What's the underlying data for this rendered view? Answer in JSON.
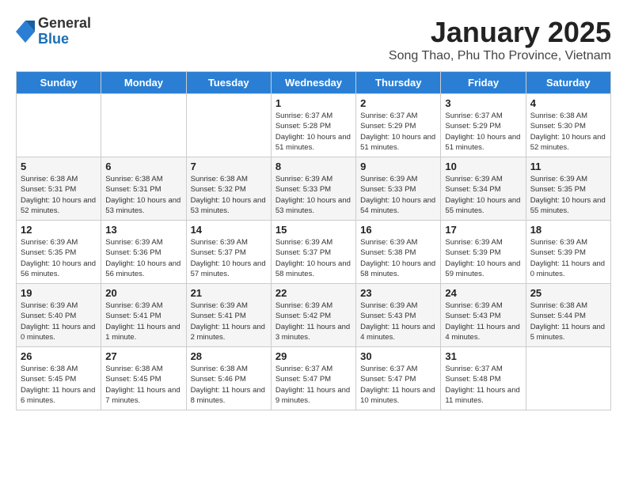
{
  "header": {
    "logo_general": "General",
    "logo_blue": "Blue",
    "month_title": "January 2025",
    "location": "Song Thao, Phu Tho Province, Vietnam"
  },
  "days_of_week": [
    "Sunday",
    "Monday",
    "Tuesday",
    "Wednesday",
    "Thursday",
    "Friday",
    "Saturday"
  ],
  "weeks": [
    [
      {
        "day": "",
        "info": ""
      },
      {
        "day": "",
        "info": ""
      },
      {
        "day": "",
        "info": ""
      },
      {
        "day": "1",
        "info": "Sunrise: 6:37 AM\nSunset: 5:28 PM\nDaylight: 10 hours\nand 51 minutes."
      },
      {
        "day": "2",
        "info": "Sunrise: 6:37 AM\nSunset: 5:29 PM\nDaylight: 10 hours\nand 51 minutes."
      },
      {
        "day": "3",
        "info": "Sunrise: 6:37 AM\nSunset: 5:29 PM\nDaylight: 10 hours\nand 51 minutes."
      },
      {
        "day": "4",
        "info": "Sunrise: 6:38 AM\nSunset: 5:30 PM\nDaylight: 10 hours\nand 52 minutes."
      }
    ],
    [
      {
        "day": "5",
        "info": "Sunrise: 6:38 AM\nSunset: 5:31 PM\nDaylight: 10 hours\nand 52 minutes."
      },
      {
        "day": "6",
        "info": "Sunrise: 6:38 AM\nSunset: 5:31 PM\nDaylight: 10 hours\nand 53 minutes."
      },
      {
        "day": "7",
        "info": "Sunrise: 6:38 AM\nSunset: 5:32 PM\nDaylight: 10 hours\nand 53 minutes."
      },
      {
        "day": "8",
        "info": "Sunrise: 6:39 AM\nSunset: 5:33 PM\nDaylight: 10 hours\nand 53 minutes."
      },
      {
        "day": "9",
        "info": "Sunrise: 6:39 AM\nSunset: 5:33 PM\nDaylight: 10 hours\nand 54 minutes."
      },
      {
        "day": "10",
        "info": "Sunrise: 6:39 AM\nSunset: 5:34 PM\nDaylight: 10 hours\nand 55 minutes."
      },
      {
        "day": "11",
        "info": "Sunrise: 6:39 AM\nSunset: 5:35 PM\nDaylight: 10 hours\nand 55 minutes."
      }
    ],
    [
      {
        "day": "12",
        "info": "Sunrise: 6:39 AM\nSunset: 5:35 PM\nDaylight: 10 hours\nand 56 minutes."
      },
      {
        "day": "13",
        "info": "Sunrise: 6:39 AM\nSunset: 5:36 PM\nDaylight: 10 hours\nand 56 minutes."
      },
      {
        "day": "14",
        "info": "Sunrise: 6:39 AM\nSunset: 5:37 PM\nDaylight: 10 hours\nand 57 minutes."
      },
      {
        "day": "15",
        "info": "Sunrise: 6:39 AM\nSunset: 5:37 PM\nDaylight: 10 hours\nand 58 minutes."
      },
      {
        "day": "16",
        "info": "Sunrise: 6:39 AM\nSunset: 5:38 PM\nDaylight: 10 hours\nand 58 minutes."
      },
      {
        "day": "17",
        "info": "Sunrise: 6:39 AM\nSunset: 5:39 PM\nDaylight: 10 hours\nand 59 minutes."
      },
      {
        "day": "18",
        "info": "Sunrise: 6:39 AM\nSunset: 5:39 PM\nDaylight: 11 hours\nand 0 minutes."
      }
    ],
    [
      {
        "day": "19",
        "info": "Sunrise: 6:39 AM\nSunset: 5:40 PM\nDaylight: 11 hours\nand 0 minutes."
      },
      {
        "day": "20",
        "info": "Sunrise: 6:39 AM\nSunset: 5:41 PM\nDaylight: 11 hours\nand 1 minute."
      },
      {
        "day": "21",
        "info": "Sunrise: 6:39 AM\nSunset: 5:41 PM\nDaylight: 11 hours\nand 2 minutes."
      },
      {
        "day": "22",
        "info": "Sunrise: 6:39 AM\nSunset: 5:42 PM\nDaylight: 11 hours\nand 3 minutes."
      },
      {
        "day": "23",
        "info": "Sunrise: 6:39 AM\nSunset: 5:43 PM\nDaylight: 11 hours\nand 4 minutes."
      },
      {
        "day": "24",
        "info": "Sunrise: 6:39 AM\nSunset: 5:43 PM\nDaylight: 11 hours\nand 4 minutes."
      },
      {
        "day": "25",
        "info": "Sunrise: 6:38 AM\nSunset: 5:44 PM\nDaylight: 11 hours\nand 5 minutes."
      }
    ],
    [
      {
        "day": "26",
        "info": "Sunrise: 6:38 AM\nSunset: 5:45 PM\nDaylight: 11 hours\nand 6 minutes."
      },
      {
        "day": "27",
        "info": "Sunrise: 6:38 AM\nSunset: 5:45 PM\nDaylight: 11 hours\nand 7 minutes."
      },
      {
        "day": "28",
        "info": "Sunrise: 6:38 AM\nSunset: 5:46 PM\nDaylight: 11 hours\nand 8 minutes."
      },
      {
        "day": "29",
        "info": "Sunrise: 6:37 AM\nSunset: 5:47 PM\nDaylight: 11 hours\nand 9 minutes."
      },
      {
        "day": "30",
        "info": "Sunrise: 6:37 AM\nSunset: 5:47 PM\nDaylight: 11 hours\nand 10 minutes."
      },
      {
        "day": "31",
        "info": "Sunrise: 6:37 AM\nSunset: 5:48 PM\nDaylight: 11 hours\nand 11 minutes."
      },
      {
        "day": "",
        "info": ""
      }
    ]
  ]
}
